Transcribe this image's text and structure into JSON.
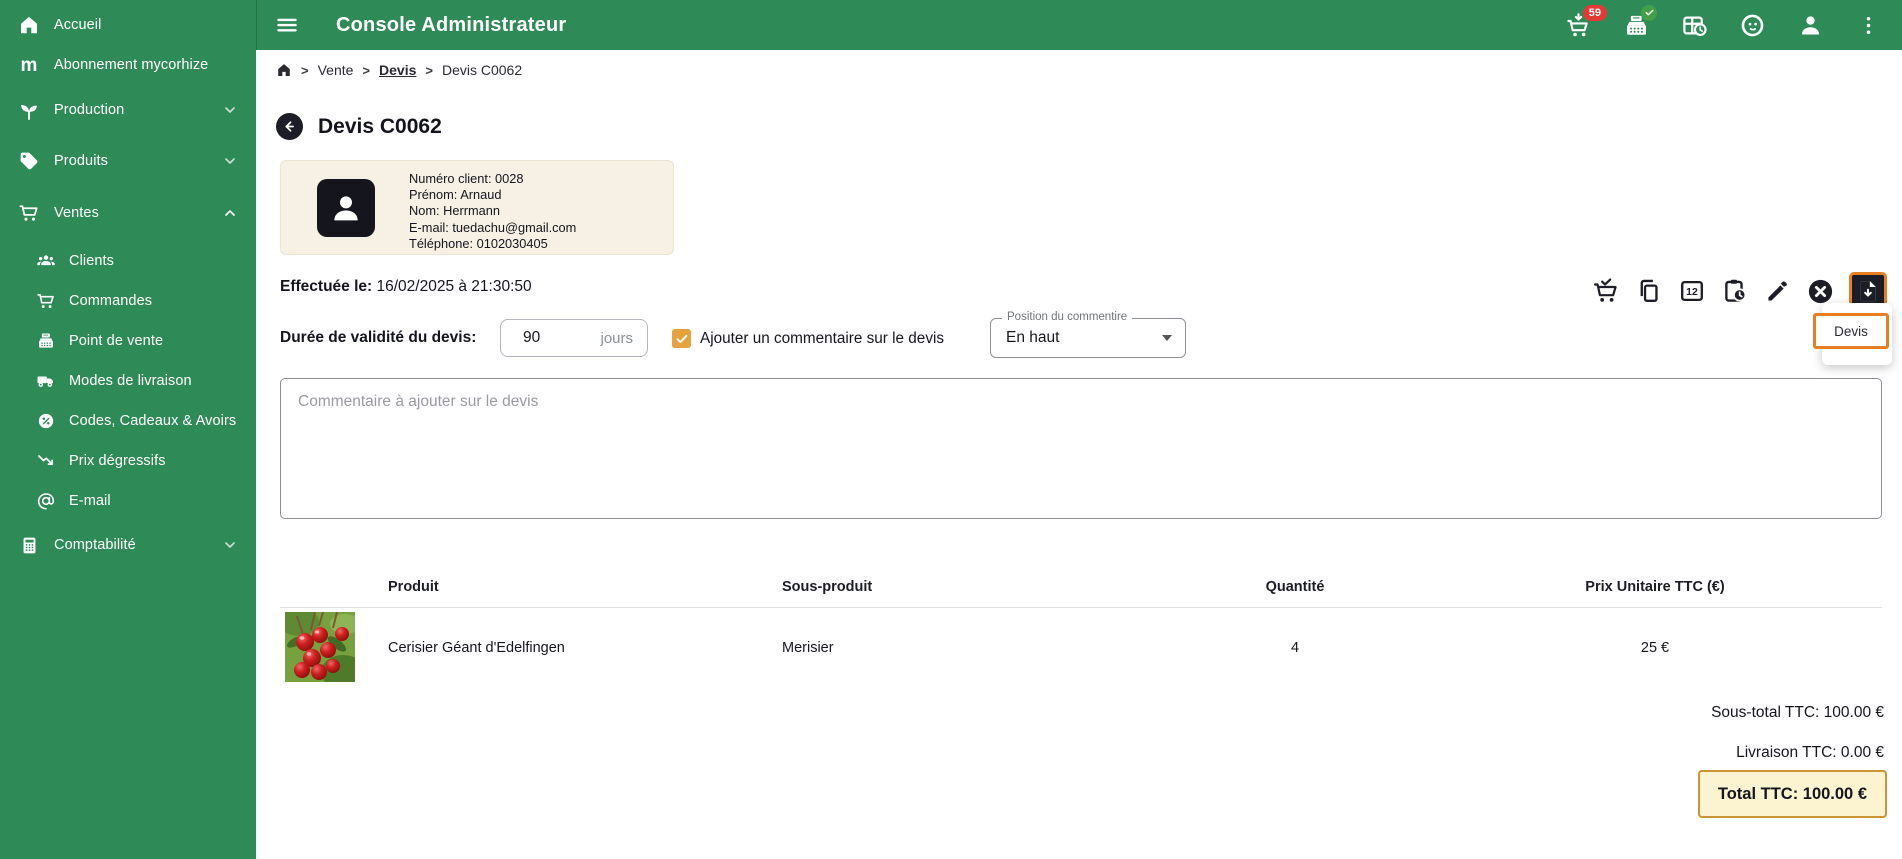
{
  "header": {
    "title": "Console Administrateur",
    "cart_badge": "59"
  },
  "sidebar": {
    "items": [
      {
        "label": "Accueil"
      },
      {
        "label": "Abonnement mycorhize"
      },
      {
        "label": "Production"
      },
      {
        "label": "Produits"
      },
      {
        "label": "Ventes"
      },
      {
        "label": "Clients"
      },
      {
        "label": "Commandes"
      },
      {
        "label": "Point de vente"
      },
      {
        "label": "Modes de livraison"
      },
      {
        "label": "Codes, Cadeaux & Avoirs"
      },
      {
        "label": "Prix dégressifs"
      },
      {
        "label": "E-mail"
      },
      {
        "label": "Comptabilité"
      }
    ]
  },
  "breadcrumb": {
    "separator": ">",
    "items": [
      {
        "label": "Vente"
      },
      {
        "label": "Devis"
      },
      {
        "label": "Devis C0062"
      }
    ]
  },
  "page": {
    "title": "Devis C0062"
  },
  "customer": {
    "lines": [
      "Numéro client: 0028",
      "Prénom: Arnaud",
      "Nom: Herrmann",
      "E-mail: tuedachu@gmail.com",
      "Téléphone: 0102030405"
    ]
  },
  "quote": {
    "created_label": "Effectuée le:",
    "created_value": "16/02/2025 à 21:30:50",
    "validity_label": "Durée de validité du devis:",
    "validity_value": "90",
    "validity_unit": "jours",
    "comment_checkbox_label": "Ajouter un commentaire sur le devis",
    "comment_checkbox_checked": true,
    "comment_position_label": "Position du commentire",
    "comment_position_value": "En haut",
    "comment_placeholder": "Commentaire à ajouter sur le devis"
  },
  "actions": {
    "menu": {
      "items": [
        {
          "label": "Devis"
        }
      ]
    }
  },
  "table": {
    "headers": [
      "Produit",
      "Sous-produit",
      "Quantité",
      "Prix Unitaire TTC (€)"
    ],
    "rows": [
      {
        "product": "Cerisier Géant d'Edelfingen",
        "sub_product": "Merisier",
        "quantity": "4",
        "unit_price": "25 €"
      }
    ]
  },
  "totals": {
    "subtotal": "Sous-total TTC: 100.00 €",
    "shipping": "Livraison TTC: 0.00 €",
    "total": "Total TTC: 100.00 €"
  },
  "colors": {
    "sidebar_green": "#2e8b57",
    "checkbox_amber": "#e6a23c",
    "highlight_orange": "#e87e22",
    "badge_red": "#e53935",
    "badge_green": "#43a047",
    "customer_card_bg": "#f6f1e4",
    "total_box_bg": "#fcf3d1",
    "total_box_border": "#cd9337"
  }
}
